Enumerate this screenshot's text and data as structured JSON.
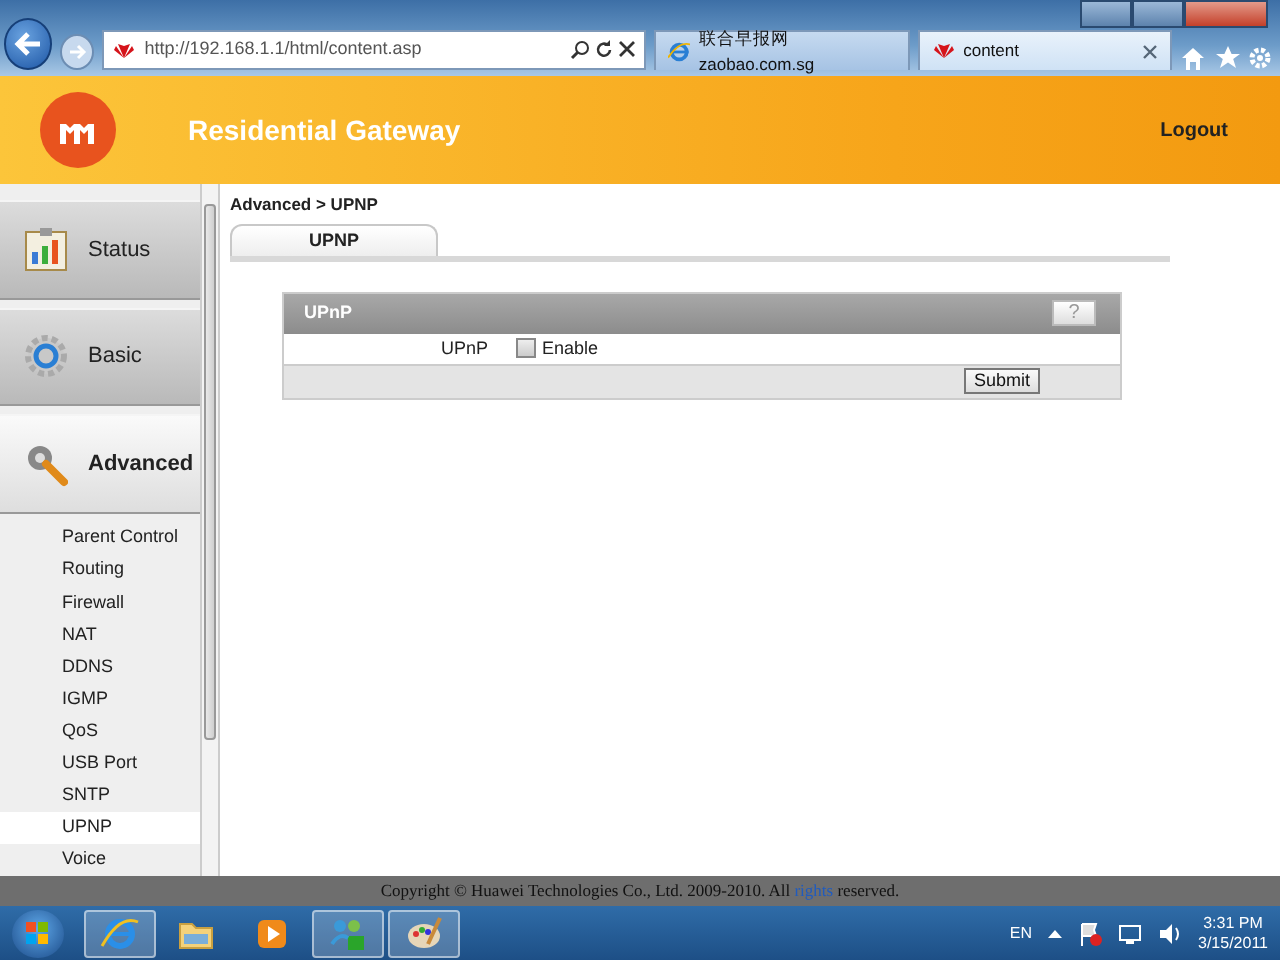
{
  "browser": {
    "address": "http://192.168.1.1/html/content.asp",
    "tabs": [
      {
        "title": "联合早报网 zaobao.com.sg",
        "kind": "ie",
        "selected": false
      },
      {
        "title": "content",
        "kind": "huawei",
        "selected": true
      }
    ]
  },
  "header": {
    "title": "Residential Gateway",
    "logout": "Logout"
  },
  "sidebar": {
    "groups": [
      {
        "label": "Status",
        "kind": "chart",
        "selected": false
      },
      {
        "label": "Basic",
        "kind": "gear",
        "selected": false
      },
      {
        "label": "Advanced",
        "kind": "wrench",
        "selected": true
      }
    ],
    "items": [
      {
        "label": "Parent Control",
        "selected": false
      },
      {
        "label": "Routing",
        "selected": false
      },
      {
        "label": "Firewall",
        "selected": false
      },
      {
        "label": "NAT",
        "selected": false
      },
      {
        "label": "DDNS",
        "selected": false
      },
      {
        "label": "IGMP",
        "selected": false
      },
      {
        "label": "QoS",
        "selected": false
      },
      {
        "label": "USB Port",
        "selected": false
      },
      {
        "label": "SNTP",
        "selected": false
      },
      {
        "label": "UPNP",
        "selected": true
      },
      {
        "label": "Voice",
        "selected": false
      }
    ]
  },
  "breadcrumb": "Advanced > UPNP",
  "page_tabs": [
    {
      "label": "UPNP",
      "selected": true
    }
  ],
  "panel": {
    "title": "UPnP",
    "help": "?",
    "field_label": "UPnP",
    "checkbox": {
      "label": "Enable",
      "checked": false
    },
    "submit": "Submit"
  },
  "footer": {
    "text_before": "Copyright © Huawei Technologies Co., Ltd. 2009-2010. All",
    "link": "rights",
    "text_after": "reserved."
  },
  "taskbar": {
    "apps": [
      {
        "kind": "browser",
        "running": true
      },
      {
        "kind": "folder",
        "running": false
      },
      {
        "kind": "media",
        "running": false
      },
      {
        "kind": "network",
        "running": true
      },
      {
        "kind": "paint",
        "running": true
      }
    ],
    "language": "EN",
    "time": "3:31 PM",
    "date": "3/15/2011"
  }
}
